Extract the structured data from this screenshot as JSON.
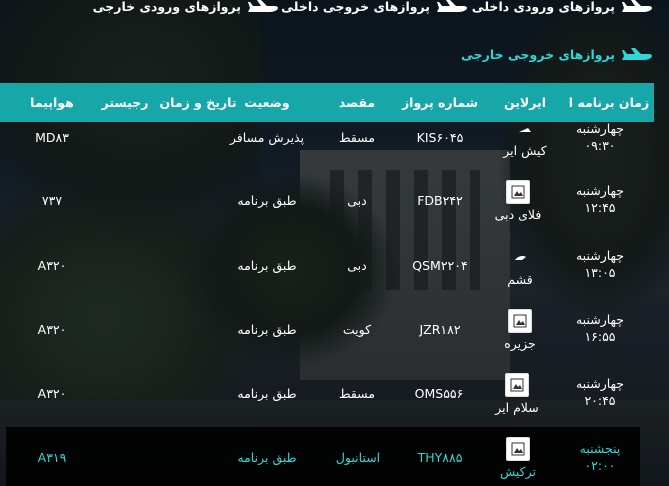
{
  "nav": {
    "links": [
      {
        "label": "پروازهای ورودی داخلی"
      },
      {
        "label": "پروازهای خروجی داخلی"
      },
      {
        "label": "پروازهای ورودی خارجی"
      }
    ],
    "active_section": "پروازهای خروجی خارجی"
  },
  "colors": {
    "accent": "#17a7a8",
    "highlight_text": "#2fd7d7"
  },
  "table": {
    "headers": {
      "time": "زمان برنامه ا",
      "airline": "ایرلاین",
      "flight": "شماره پرواز",
      "destination": "مقصد",
      "status": "وضعیت",
      "datetime": "تاریخ و زمان",
      "register": "رجیستر",
      "aircraft": "هواپیما"
    },
    "rows": [
      {
        "day": "چهارشنبه",
        "time": "۰۹:۳۰",
        "airline": "کیش ایر",
        "flight": "KIS۶۰۴۵",
        "destination": "مسقط",
        "status": "پذیرش مسافر",
        "aircraft": "MD۸۳"
      },
      {
        "day": "چهارشنبه",
        "time": "۱۲:۴۵",
        "airline": "فلای دبی",
        "flight": "FDB۲۴۲",
        "destination": "دبی",
        "status": "طبق برنامه",
        "aircraft": "۷۳۷"
      },
      {
        "day": "چهارشنبه",
        "time": "۱۳:۰۵",
        "airline": "قشم",
        "flight": "QSM۲۲۰۴",
        "destination": "دبی",
        "status": "طبق برنامه",
        "aircraft": "A۳۲۰"
      },
      {
        "day": "چهارشنبه",
        "time": "۱۶:۵۵",
        "airline": "جزیره",
        "flight": "JZR۱۸۲",
        "destination": "کویت",
        "status": "طبق برنامه",
        "aircraft": "A۳۲۰"
      },
      {
        "day": "چهارشنبه",
        "time": "۲۰:۴۵",
        "airline": "سلام ایر",
        "flight": "OMS۵۵۶",
        "destination": "مسقط",
        "status": "طبق برنامه",
        "aircraft": "A۳۲۰"
      },
      {
        "day": "پنجشنبه",
        "time": "۰۲:۰۰",
        "airline": "ترکیش",
        "flight": "THY۸۸۵",
        "destination": "استانبول",
        "status": "طبق برنامه",
        "aircraft": "A۳۱۹"
      }
    ]
  }
}
